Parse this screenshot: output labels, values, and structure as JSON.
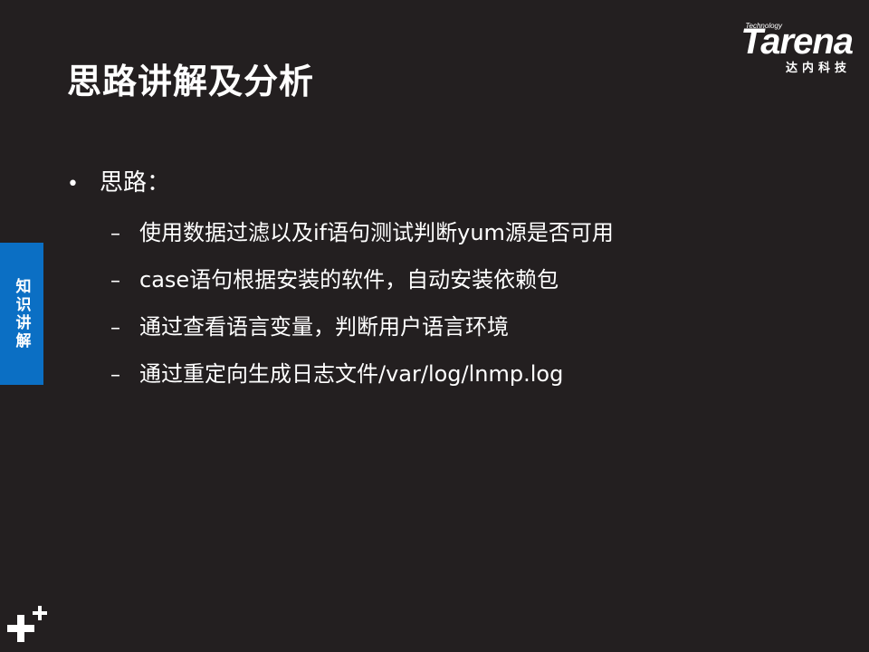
{
  "slide": {
    "title": "思路讲解及分析",
    "logo": {
      "tagline": "Technology",
      "name": "Tarena",
      "chinese": "达内科技"
    },
    "section_tag": "知识讲解",
    "bullet": {
      "symbol": "•",
      "text": "思路："
    },
    "sub_dash": "–",
    "sub_items": [
      "使用数据过滤以及if语句测试判断yum源是否可用",
      "case语句根据安装的软件，自动安装依赖包",
      "通过查看语言变量，判断用户语言环境",
      "通过重定向生成日志文件/var/log/lnmp.log"
    ],
    "colors": {
      "background": "#231f20",
      "text": "#ffffff",
      "section_tag": "#0b6fc4"
    },
    "icons": {
      "corner_mark": "plus-mark-icon"
    }
  }
}
